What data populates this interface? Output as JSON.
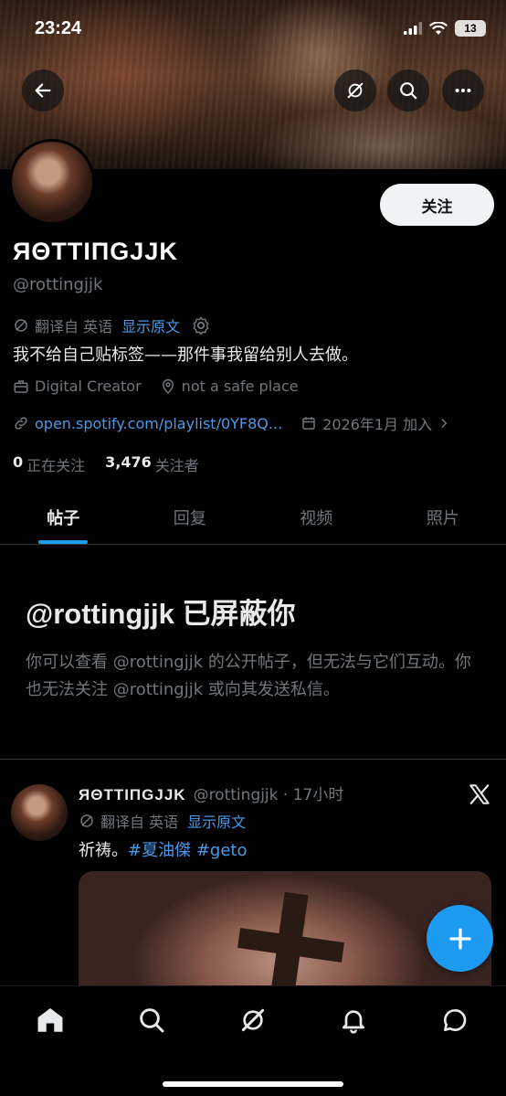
{
  "status_bar": {
    "time": "23:24",
    "battery": "13"
  },
  "profile": {
    "display_name": "ЯΘTTIПGJJK",
    "handle": "@rottingjjk",
    "follow_label": "关注",
    "translate_label": "翻译自 英语",
    "show_original": "显示原文",
    "bio": "我不给自己贴标签——那件事我留给别人去做。",
    "category": "Digital Creator",
    "location": "not a safe place",
    "url": "open.spotify.com/playlist/0YF8Q...",
    "joined": "2026年1月 加入",
    "following_count": "0",
    "following_label": "正在关注",
    "followers_count": "3,476",
    "followers_label": "关注者"
  },
  "tabs": [
    {
      "label": "帖子",
      "active": true
    },
    {
      "label": "回复"
    },
    {
      "label": "视频"
    },
    {
      "label": "照片"
    }
  ],
  "blocked": {
    "title": "@rottingjjk 已屏蔽你",
    "message": "你可以查看 @rottingjjk 的公开帖子，但无法与它们互动。你也无法关注 @rottingjjk 或向其发送私信。"
  },
  "post": {
    "name": "ЯΘTTIПGJJK",
    "handle_time": "@rottingjjk · 17小时",
    "translate_label": "翻译自 英语",
    "show_original": "显示原文",
    "text": "祈祷。",
    "hashtag1": "#夏油傑",
    "hashtag2": "#geto"
  },
  "colors": {
    "accent": "#1d9bf0",
    "link": "#4a99e9",
    "muted": "#71767b"
  }
}
